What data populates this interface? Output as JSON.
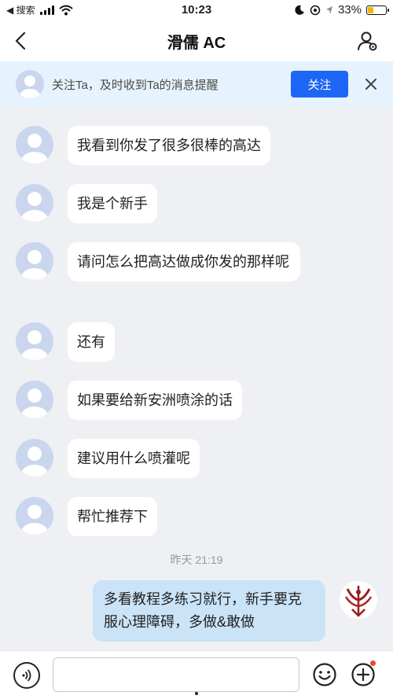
{
  "status_bar": {
    "back_app": "◀ 搜索",
    "time": "10:23",
    "battery_percent": "33%",
    "battery_level": 0.33,
    "icons": [
      "signal-icon",
      "wifi-icon",
      "moon-icon",
      "location-icon",
      "battery-icon"
    ]
  },
  "nav": {
    "title": "滑儒 AC",
    "icons": [
      "back-chevron-icon",
      "user-settings-icon"
    ]
  },
  "follow_banner": {
    "text": "关注Ta，及时收到Ta的消息提醒",
    "button_label": "关注",
    "button_color": "#1e66f5",
    "background_color": "#e6f2fd"
  },
  "messages": [
    {
      "text": "我看到你发了很多很棒的高达"
    },
    {
      "text": "我是个新手"
    },
    {
      "text": "请问怎么把高达做成你发的那样呢"
    },
    {
      "text": "还有"
    },
    {
      "text": "如果要给新安洲喷涂的话"
    },
    {
      "text": "建议用什么喷灌呢"
    },
    {
      "text": "帮忙推荐下"
    }
  ],
  "timestamp": "昨天 21:19",
  "outgoing": {
    "text": "多看教程多练习就行，新手要克服心理障碍，多做&敢做",
    "bubble_color": "#cbe3f7"
  },
  "input_bar": {
    "value": "",
    "icons": [
      "voice-icon",
      "emoji-icon",
      "plus-icon"
    ],
    "badge_color": "#f2442e"
  }
}
